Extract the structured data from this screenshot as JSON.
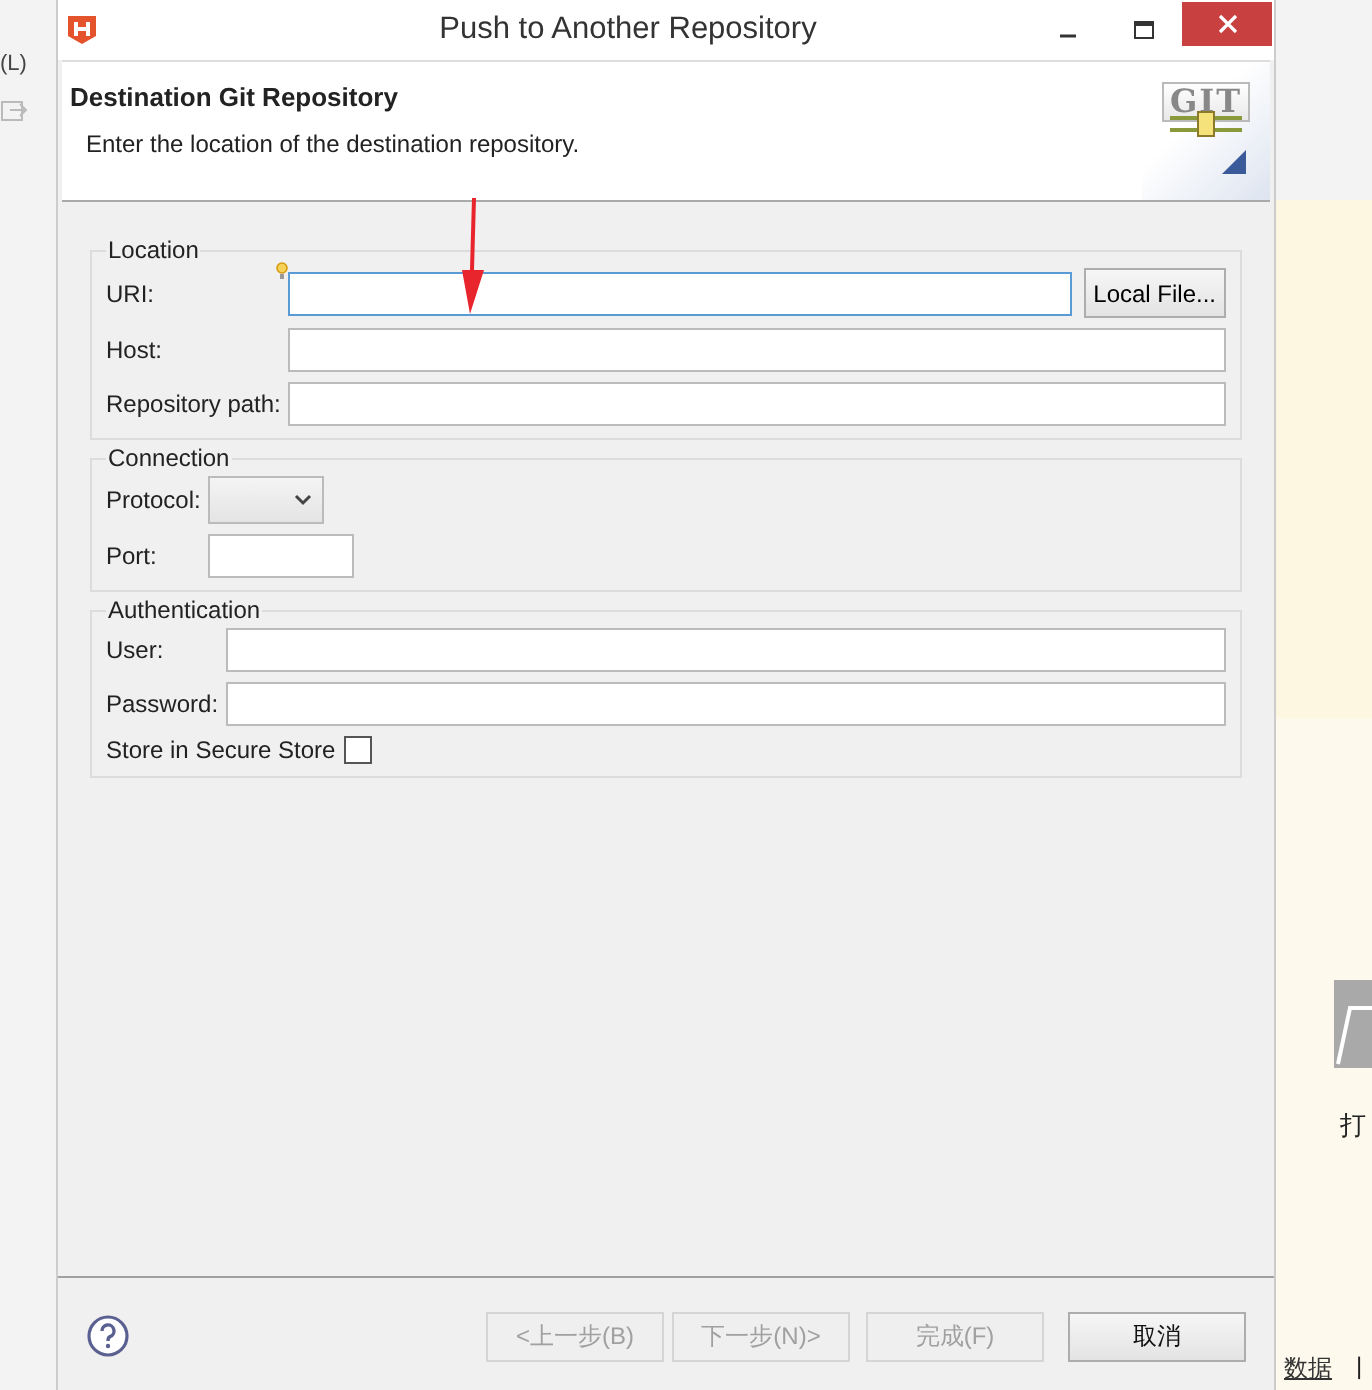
{
  "background_app": {
    "menu_fragment": "(L)",
    "side_text": "打",
    "link": "数据",
    "separator": "|"
  },
  "window": {
    "title": "Push to Another Repository"
  },
  "header": {
    "title": "Destination Git Repository",
    "description": "Enter the location of the destination repository.",
    "logo_text": "GIT"
  },
  "groups": [
    {
      "title": "Location",
      "fields": [
        {
          "kind": "text",
          "label": "URI:",
          "focused": true,
          "hint": true,
          "button": "Local File..."
        },
        {
          "kind": "text",
          "label": "Host:",
          "focused": false,
          "hint": false
        },
        {
          "kind": "text",
          "label": "Repository path:",
          "focused": false,
          "hint": false
        }
      ]
    },
    {
      "title": "Connection",
      "fields": [
        {
          "kind": "select",
          "label": "Protocol:"
        },
        {
          "kind": "short",
          "label": "Port:",
          "focused": false,
          "hint": false
        }
      ]
    },
    {
      "title": "Authentication",
      "fields": [
        {
          "kind": "text",
          "label": "User:",
          "focused": false,
          "hint": false
        },
        {
          "kind": "text",
          "label": "Password:",
          "focused": false,
          "hint": false
        },
        {
          "kind": "checkbox",
          "label": "Store in Secure Store",
          "checked": false
        }
      ]
    }
  ],
  "buttons": [
    {
      "label": "<上一步(B)",
      "disabled": true
    },
    {
      "label": "下一步(N)>",
      "disabled": true
    },
    {
      "label": "完成(F)",
      "disabled": true
    },
    {
      "label": "取消",
      "disabled": false
    }
  ]
}
